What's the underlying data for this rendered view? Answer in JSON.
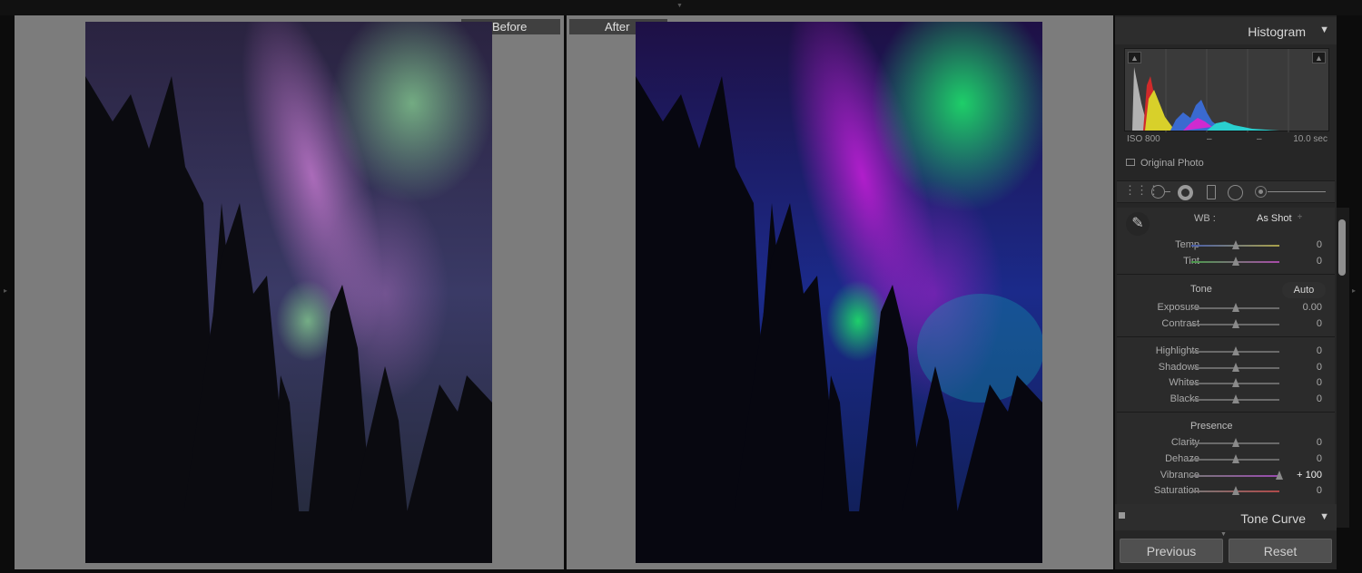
{
  "compare": {
    "before_label": "Before",
    "after_label": "After"
  },
  "histogram": {
    "title": "Histogram",
    "iso": "ISO 800",
    "dash1": "–",
    "dash2": "–",
    "shutter": "10.0 sec",
    "original_photo_label": "Original Photo"
  },
  "tools": [
    "crop-overlay",
    "spot-removal",
    "red-eye-correction",
    "graduated-filter",
    "radial-filter",
    "adjustment-brush"
  ],
  "basic": {
    "wb_label": "WB :",
    "wb_value": "As Shot",
    "wb_stepper": "÷",
    "temp": {
      "label": "Temp",
      "value": "0",
      "level": 0.5
    },
    "tint": {
      "label": "Tint",
      "value": "0",
      "level": 0.5
    },
    "tone_title": "Tone",
    "auto_label": "Auto",
    "exposure": {
      "label": "Exposure",
      "value": "0.00",
      "level": 0.5
    },
    "contrast": {
      "label": "Contrast",
      "value": "0",
      "level": 0.5
    },
    "highlights": {
      "label": "Highlights",
      "value": "0",
      "level": 0.5
    },
    "shadows": {
      "label": "Shadows",
      "value": "0",
      "level": 0.5
    },
    "whites": {
      "label": "Whites",
      "value": "0",
      "level": 0.5
    },
    "blacks": {
      "label": "Blacks",
      "value": "0",
      "level": 0.5
    },
    "presence_title": "Presence",
    "clarity": {
      "label": "Clarity",
      "value": "0",
      "level": 0.5
    },
    "dehaze": {
      "label": "Dehaze",
      "value": "0",
      "level": 0.5
    },
    "vibrance": {
      "label": "Vibrance",
      "value": "+ 100",
      "level": 1.0
    },
    "saturation": {
      "label": "Saturation",
      "value": "0",
      "level": 0.5
    }
  },
  "tone_curve": {
    "title": "Tone Curve"
  },
  "bottom": {
    "previous_label": "Previous",
    "reset_label": "Reset"
  },
  "colors": {
    "temp_gradient": [
      "#4a5ea8",
      "#a8a04a"
    ],
    "tint_gradient": [
      "#4a9a4a",
      "#a84aa8"
    ],
    "vibrance_gradient": [
      "#777777",
      "#9a4ab0"
    ],
    "saturation_gradient": [
      "#777777",
      "#b04a4a"
    ]
  }
}
